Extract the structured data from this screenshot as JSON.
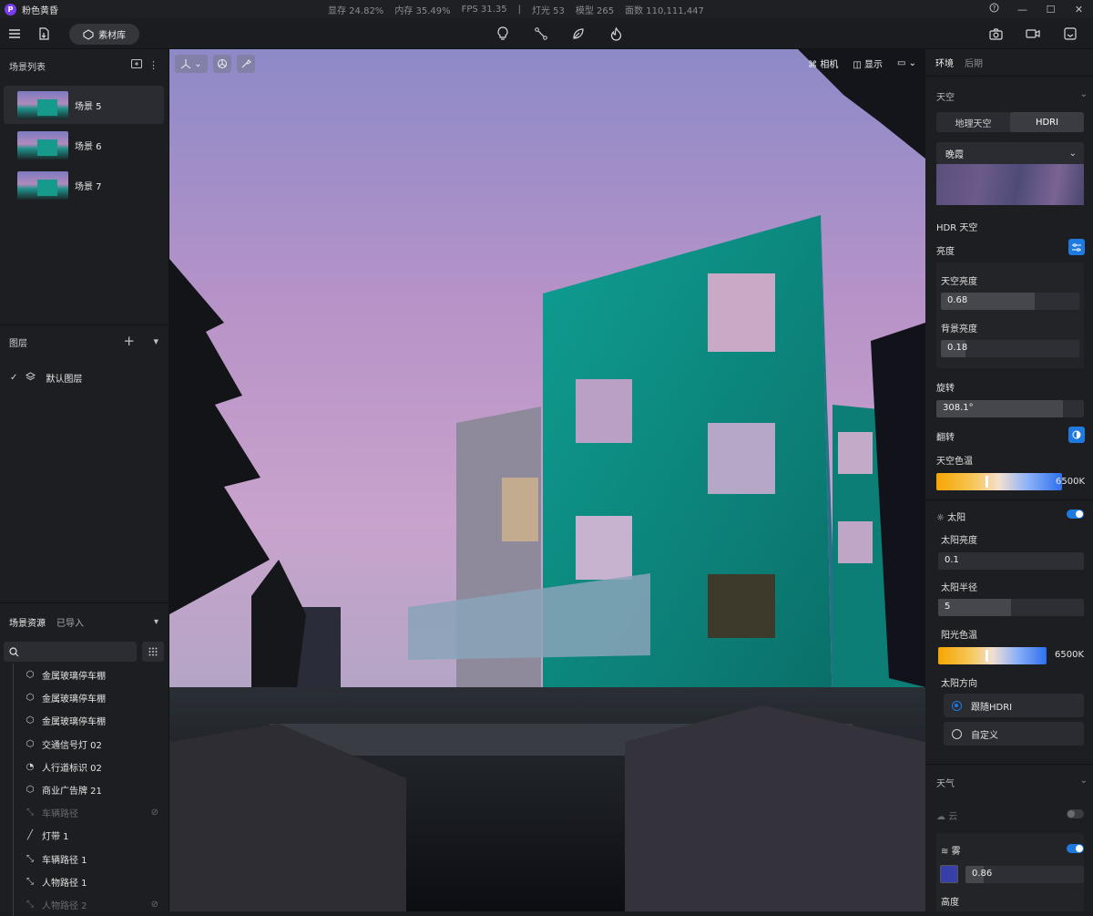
{
  "app": {
    "title": "粉色黄昏",
    "logo": "P",
    "stats": [
      "显存 24.82%",
      "内存 35.49%",
      "FPS 31.35",
      "|",
      "灯光 53",
      "模型 265",
      "面数 110,111,447"
    ],
    "window_controls": [
      "help-icon",
      "minimize-icon",
      "maximize-icon",
      "close-icon"
    ]
  },
  "toolbar": {
    "assets_label": "素材库",
    "center_icons": [
      "light-bulb-icon",
      "path-icon",
      "leaf-icon",
      "fire-icon"
    ],
    "right_icons": [
      "camera-icon",
      "video-icon",
      "export-icon"
    ]
  },
  "scene_list": {
    "title": "场景列表",
    "items": [
      {
        "label": "场景 5",
        "selected": true
      },
      {
        "label": "场景 6",
        "selected": false
      },
      {
        "label": "场景 7",
        "selected": false
      }
    ]
  },
  "layers": {
    "title": "图层",
    "items": [
      {
        "label": "默认图层",
        "checked": true
      }
    ]
  },
  "assets": {
    "tab_scene": "场景资源",
    "tab_imported": "已导入",
    "search_placeholder": "",
    "items": [
      {
        "label": "金属玻璃停车棚",
        "icon": "cube-icon",
        "dim": false,
        "hidden": false
      },
      {
        "label": "金属玻璃停车棚",
        "icon": "cube-icon",
        "dim": false,
        "hidden": false
      },
      {
        "label": "金属玻璃停车棚",
        "icon": "cube-icon",
        "dim": false,
        "hidden": false
      },
      {
        "label": "交通信号灯 02",
        "icon": "cube-icon",
        "dim": false,
        "hidden": false
      },
      {
        "label": "人行道标识 02",
        "icon": "pie-icon",
        "dim": false,
        "hidden": false
      },
      {
        "label": "商业广告牌 21",
        "icon": "cube-icon",
        "dim": false,
        "hidden": false
      },
      {
        "label": "车辆路径",
        "icon": "path-icon",
        "dim": true,
        "hidden": true
      },
      {
        "label": "灯带 1",
        "icon": "line-icon",
        "dim": false,
        "hidden": false
      },
      {
        "label": "车辆路径 1",
        "icon": "path-icon",
        "dim": false,
        "hidden": false
      },
      {
        "label": "人物路径 1",
        "icon": "path-icon",
        "dim": false,
        "hidden": false
      },
      {
        "label": "人物路径 2",
        "icon": "path-icon",
        "dim": true,
        "hidden": true
      }
    ]
  },
  "viewport": {
    "camera_label": "相机",
    "display_label": "显示"
  },
  "env_panel": {
    "tab_env": "环境",
    "tab_post": "后期",
    "sky": {
      "title": "天空",
      "seg_geo": "地理天空",
      "seg_hdri": "HDRI",
      "preset": "晚霞",
      "hdr_label": "HDR 天空",
      "brightness_label": "亮度",
      "sky_brightness_label": "天空亮度",
      "sky_brightness": "0.68",
      "sky_brightness_level": 0.68,
      "bg_brightness_label": "背景亮度",
      "bg_brightness": "0.18",
      "bg_brightness_level": 0.18,
      "rotation_label": "旋转",
      "rotation": "308.1°",
      "rotation_level": 0.86,
      "flip_label": "翻转",
      "color_temp_label": "天空色温",
      "color_temp": "6500K"
    },
    "sun": {
      "title": "太阳",
      "enabled": true,
      "brightness_label": "太阳亮度",
      "brightness": "0.1",
      "radius_label": "太阳半径",
      "radius": "5",
      "color_temp_label": "阳光色温",
      "color_temp": "6500K",
      "direction_label": "太阳方向",
      "opt_follow": "跟随HDRI",
      "opt_custom": "自定义"
    },
    "weather": {
      "title": "天气",
      "cloud_label": "云",
      "cloud_enabled": false,
      "fog_label": "雾",
      "fog_enabled": true,
      "fog_value": "0.86",
      "fog_color": "#3740a8",
      "height_label": "高度"
    }
  }
}
